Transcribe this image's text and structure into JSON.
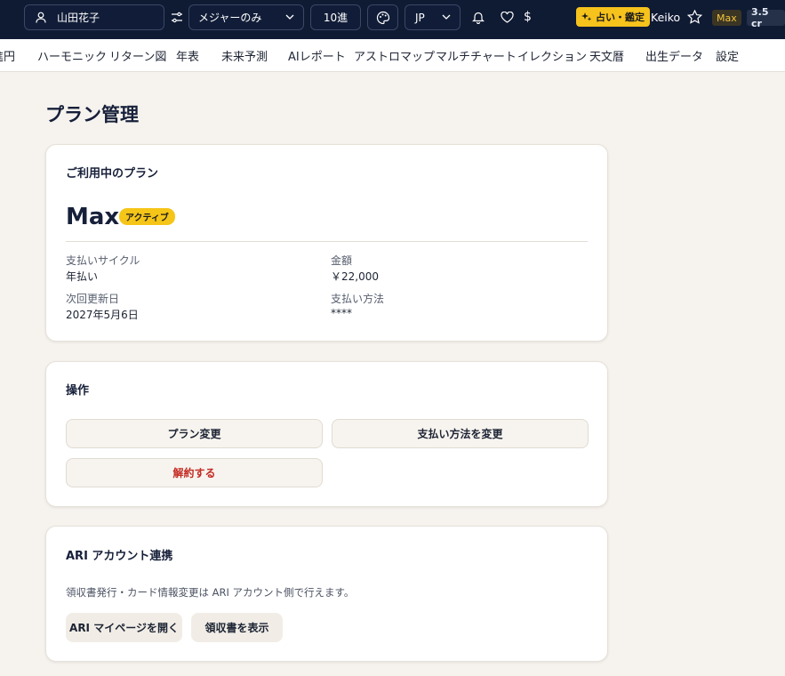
{
  "header": {
    "user_name": "山田花子",
    "chart_mode": "メジャーのみ",
    "number_system": "10進",
    "language": "JP",
    "fortune_button": "占い・鑑定",
    "account_name": "Keiko",
    "plan_badge": "Max",
    "credits": "3.5 cr"
  },
  "nav": {
    "items": [
      "進円",
      "ハーモニック",
      "リターン図",
      "年表",
      "未来予測",
      "AIレポート",
      "アストロマップ",
      "マルチチャート",
      "イレクション",
      "天文暦",
      "出生データ",
      "設定"
    ]
  },
  "page": {
    "title": "プラン管理"
  },
  "current_plan": {
    "title": "ご利用中のプラン",
    "plan_name": "Max",
    "status": "アクティブ",
    "billing_cycle_label": "支払いサイクル",
    "billing_cycle_value": "年払い",
    "amount_label": "金額",
    "amount_value": "￥22,000",
    "next_renewal_label": "次回更新日",
    "next_renewal_value": "2027年5月6日",
    "payment_method_label": "支払い方法",
    "payment_method_value": "****"
  },
  "operations": {
    "title": "操作",
    "change_plan": "プラン変更",
    "change_payment": "支払い方法を変更",
    "cancel": "解約する"
  },
  "ari": {
    "title": "ARI アカウント連携",
    "description": "領収書発行・カード情報変更は ARI アカウント側で行えます。",
    "open_mypage": "ARI マイページを開く",
    "show_receipt": "領収書を表示"
  }
}
